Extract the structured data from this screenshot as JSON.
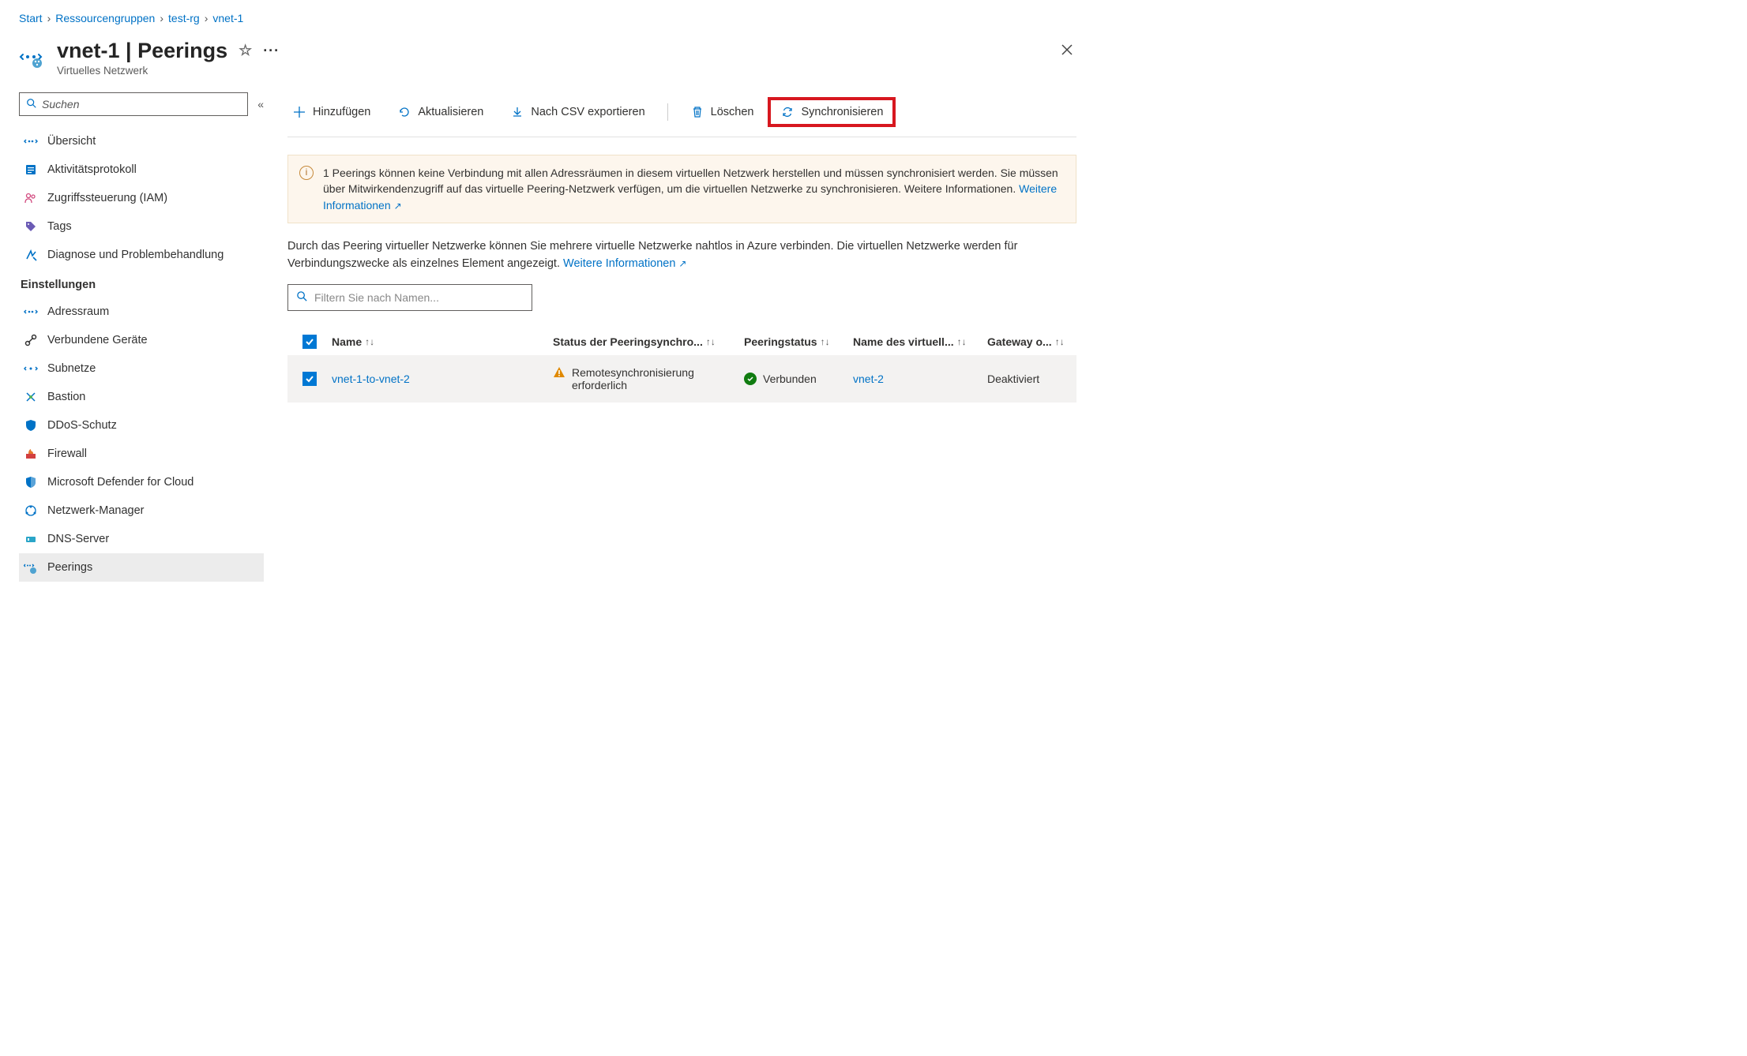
{
  "breadcrumb": {
    "items": [
      "Start",
      "Ressourcengruppen",
      "test-rg",
      "vnet-1"
    ]
  },
  "header": {
    "title": "vnet-1 | Peerings",
    "subtitle": "Virtuelles Netzwerk"
  },
  "sidebar": {
    "search_placeholder": "Suchen",
    "section_settings": "Einstellungen",
    "items_top": [
      {
        "label": "Übersicht"
      },
      {
        "label": "Aktivitätsprotokoll"
      },
      {
        "label": "Zugriffssteuerung (IAM)"
      },
      {
        "label": "Tags"
      },
      {
        "label": "Diagnose und Problembehandlung"
      }
    ],
    "items_settings": [
      {
        "label": "Adressraum"
      },
      {
        "label": "Verbundene Geräte"
      },
      {
        "label": "Subnetze"
      },
      {
        "label": "Bastion"
      },
      {
        "label": "DDoS-Schutz"
      },
      {
        "label": "Firewall"
      },
      {
        "label": "Microsoft Defender for Cloud"
      },
      {
        "label": "Netzwerk-Manager"
      },
      {
        "label": "DNS-Server"
      },
      {
        "label": "Peerings"
      }
    ]
  },
  "toolbar": {
    "add": "Hinzufügen",
    "refresh": "Aktualisieren",
    "export": "Nach CSV exportieren",
    "delete": "Löschen",
    "sync": "Synchronisieren"
  },
  "banner": {
    "text": "1 Peerings können keine Verbindung mit allen Adressräumen in diesem virtuellen Netzwerk herstellen und müssen synchronisiert werden. Sie müssen über Mitwirkendenzugriff auf das virtuelle Peering-Netzwerk verfügen, um die virtuellen Netzwerke zu synchronisieren. Weitere Informationen.",
    "link": "Weitere Informationen"
  },
  "description": {
    "text1": "Durch das Peering virtueller Netzwerke können Sie mehrere virtuelle Netzwerke nahtlos in Azure verbinden. Die virtuellen Netzwerke werden für Verbindungszwecke als einzelnes Element angezeigt.",
    "link": "Weitere Informationen"
  },
  "filter": {
    "placeholder": "Filtern Sie nach Namen..."
  },
  "table": {
    "headers": {
      "name": "Name",
      "sync": "Status der Peeringsynchro...",
      "status": "Peeringstatus",
      "remote": "Name des virtuell...",
      "gateway": "Gateway o..."
    },
    "rows": [
      {
        "name": "vnet-1-to-vnet-2",
        "sync": "Remotesynchronisierung erforderlich",
        "status": "Verbunden",
        "remote": "vnet-2",
        "gateway": "Deaktiviert"
      }
    ]
  }
}
